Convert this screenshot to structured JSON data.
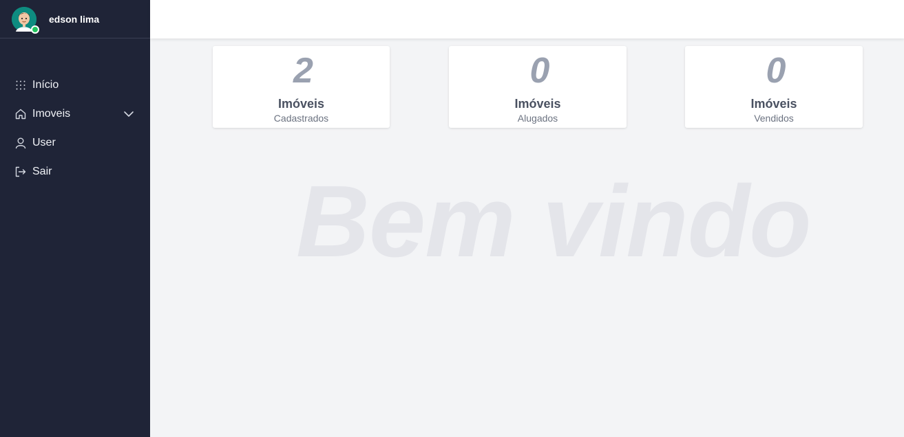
{
  "user": {
    "name": "edson lima"
  },
  "sidebar": {
    "items": [
      {
        "label": "Início",
        "icon": "grid-icon"
      },
      {
        "label": "Imoveis",
        "icon": "home-icon",
        "expandable": true
      },
      {
        "label": "User",
        "icon": "user-icon"
      },
      {
        "label": "Sair",
        "icon": "logout-icon"
      }
    ]
  },
  "cards": [
    {
      "value": "2",
      "title": "Imóveis",
      "subtitle": "Cadastrados"
    },
    {
      "value": "0",
      "title": "Imóveis",
      "subtitle": "Alugados"
    },
    {
      "value": "0",
      "title": "Imóveis",
      "subtitle": "Vendidos"
    }
  ],
  "welcome": {
    "text": "Bem vindo"
  },
  "colors": {
    "sidebar_bg": "#1f2437",
    "content_bg": "#f3f4f6",
    "online_status": "#22c55e",
    "avatar_bg": "#0e8c80"
  }
}
